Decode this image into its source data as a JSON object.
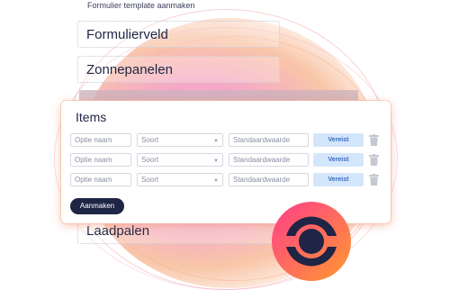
{
  "background": {
    "title": "Formulier template aanmaken",
    "fields": [
      "Formulierveld",
      "Zonnepanelen",
      "Laadpalen"
    ]
  },
  "card": {
    "title": "Items",
    "rows": [
      {
        "name_placeholder": "Optie naam",
        "type_placeholder": "Soort",
        "default_placeholder": "Standaardwaarde",
        "required_label": "Vereist"
      },
      {
        "name_placeholder": "Optie naam",
        "type_placeholder": "Soort",
        "default_placeholder": "Standaardwaarde",
        "required_label": "Vereist"
      },
      {
        "name_placeholder": "Optie naam",
        "type_placeholder": "Soort",
        "default_placeholder": "Standaardwaarde",
        "required_label": "Vereist"
      }
    ],
    "create_button": "Aanmaken"
  },
  "icons": {
    "chevron": "chevron-down-icon",
    "delete": "trash-icon",
    "logo": "brand-logo"
  },
  "colors": {
    "primary": "#1f2544",
    "required_bg": "#d4e6fb",
    "required_text": "#3a6cc0",
    "logo_gradient_start": "#ff3d8b",
    "logo_gradient_end": "#ff9a2e"
  }
}
